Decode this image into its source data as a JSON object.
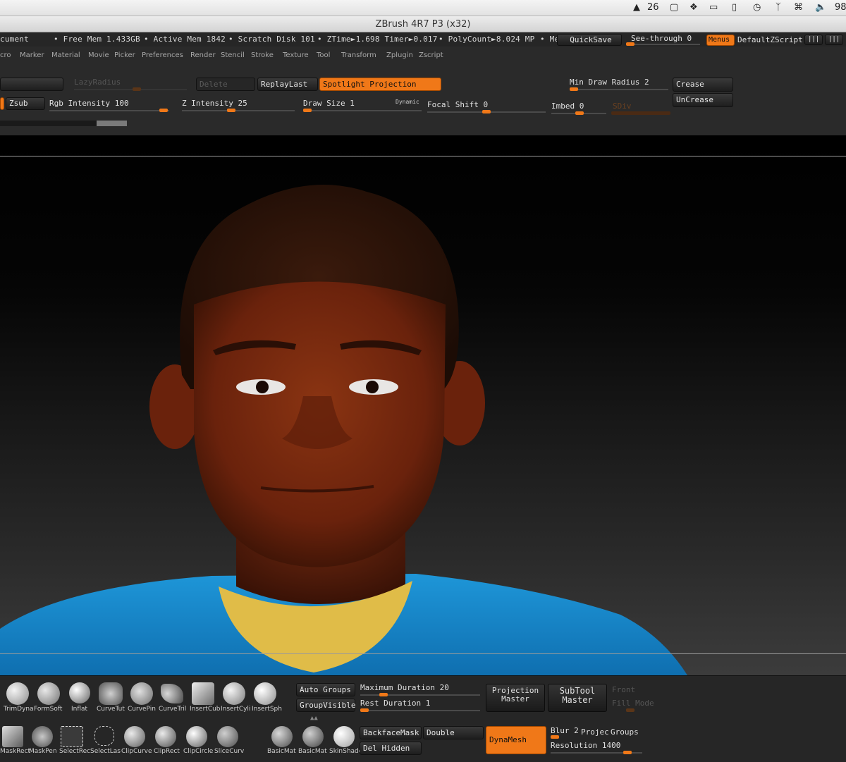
{
  "mac_menubar": {
    "adobe_badge": "26",
    "battery_partial": "98"
  },
  "window": {
    "title": "ZBrush 4R7 P3 (x32)"
  },
  "status": {
    "document": "cument",
    "free_mem": "• Free Mem 1.433GB",
    "active_mem": "• Active Mem 1842",
    "scratch_disk": "• Scratch Disk 101",
    "ztime": "• ZTime►1.698 Timer►0.017",
    "polycount": "• PolyCount►8.024 MP",
    "me": "• Me",
    "quicksave": "QuickSave",
    "see_through": "See-through  0",
    "menus": "Menus",
    "default_zscript": "DefaultZScript"
  },
  "menus": [
    "cro",
    "Marker",
    "Material",
    "Movie",
    "Picker",
    "Preferences",
    "Render",
    "Stencil",
    "Stroke",
    "Texture",
    "Tool",
    "Transform",
    "Zplugin",
    "Zscript"
  ],
  "toolbar": {
    "lazy_radius": "LazyRadius",
    "delete": "Delete",
    "replay_last": "ReplayLast",
    "spotlight_projection": "Spotlight Projection",
    "min_draw_radius": "Min Draw Radius 2",
    "crease": "Crease",
    "uncrease": "UnCrease",
    "zsub": "Zsub",
    "rgb_intensity": "Rgb Intensity 100",
    "z_intensity": "Z Intensity 25",
    "draw_size": "Draw Size 1",
    "dynamic": "Dynamic",
    "focal_shift": "Focal Shift 0",
    "imbed": "Imbed 0",
    "sdiv": "SDiv"
  },
  "shelf": {
    "brushes_top": [
      "TrimDyna",
      "FormSoft",
      "Inflat",
      "CurveTut",
      "CurvePin",
      "CurveTril",
      "InsertCub",
      "InsertCyli",
      "InsertSph"
    ],
    "brushes_bottom": [
      "MaskRect",
      "MaskPen",
      "SelectRec",
      "SelectLas",
      "ClipCurve",
      "ClipRect",
      "ClipCircle",
      "SliceCurv"
    ],
    "materials": [
      "BasicMat",
      "BasicMat",
      "SkinShade"
    ],
    "auto_groups": "Auto Groups",
    "group_visible": "GroupVisible",
    "max_duration": "Maximum Duration 20",
    "rest_duration": "Rest Duration 1",
    "projection_master": [
      "Projection",
      "Master"
    ],
    "subtool_master": [
      "SubTool",
      "Master"
    ],
    "front": "Front",
    "fill_mode": "Fill Mode",
    "backface_mask": "BackfaceMask",
    "double": "Double",
    "del_hidden": "Del Hidden",
    "dynamesh": "DynaMesh",
    "blur": "Blur 2",
    "project": "Projec",
    "groups": "Groups",
    "resolution": "Resolution 1400"
  },
  "colors": {
    "accent": "#f07818",
    "skin": "#7a2a10",
    "shirt": "#1a8cd0",
    "collar": "#e0bc48"
  }
}
